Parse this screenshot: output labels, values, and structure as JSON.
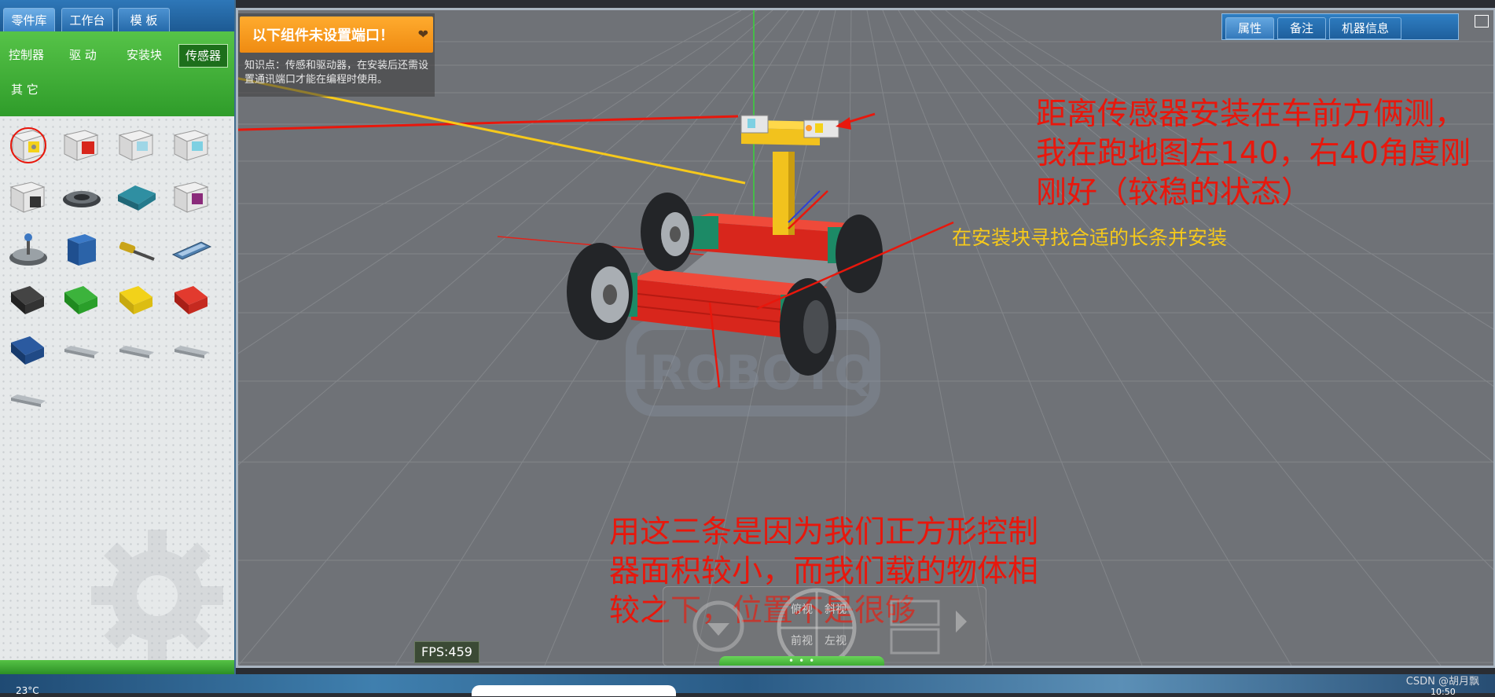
{
  "left_panel": {
    "tabs": [
      {
        "label": "零件库",
        "active": true
      },
      {
        "label": "工作台",
        "active": false
      },
      {
        "label": "模 板",
        "active": false
      }
    ],
    "categories": [
      {
        "label": "控制器",
        "active": false
      },
      {
        "label": "驱 动",
        "active": false
      },
      {
        "label": "安装块",
        "active": false
      },
      {
        "label": "传感器",
        "active": true
      },
      {
        "label": "其 它",
        "active": false
      }
    ]
  },
  "viewport": {
    "alert": {
      "title": "以下组件未设置端口！",
      "text": "知识点：传感和驱动器，在安装后还需设置通讯端口才能在编程时使用。"
    },
    "prop_tabs": [
      {
        "label": "属性",
        "active": true
      },
      {
        "label": "备注",
        "active": false
      },
      {
        "label": "机器信息",
        "active": false
      }
    ],
    "fps": "FPS:459",
    "view_controls": {
      "labels": [
        "俯视",
        "斜视",
        "前视",
        "左视"
      ]
    },
    "annotations": {
      "sensor": "距离传感器安装在车前方俩测，我在跑地图左140，右40角度刚刚好（较稳的状态）",
      "block": "在安装块寻找合适的长条并安装",
      "reason": "用这三条是因为我们正方形控制器面积较小，而我们载的物体相较之下，位置不是很够"
    },
    "colors": {
      "annotation_red": "#e8170c",
      "annotation_yellow": "#f6c91b",
      "alert_orange": "#ef8b12",
      "chassis_red": "#d8261c",
      "frame_yellow": "#f2c21d",
      "joint_green": "#1c8a66"
    }
  },
  "taskbar": {
    "temperature": "23°C",
    "watermark": "CSDN @胡月飘",
    "clock": "10:50"
  }
}
